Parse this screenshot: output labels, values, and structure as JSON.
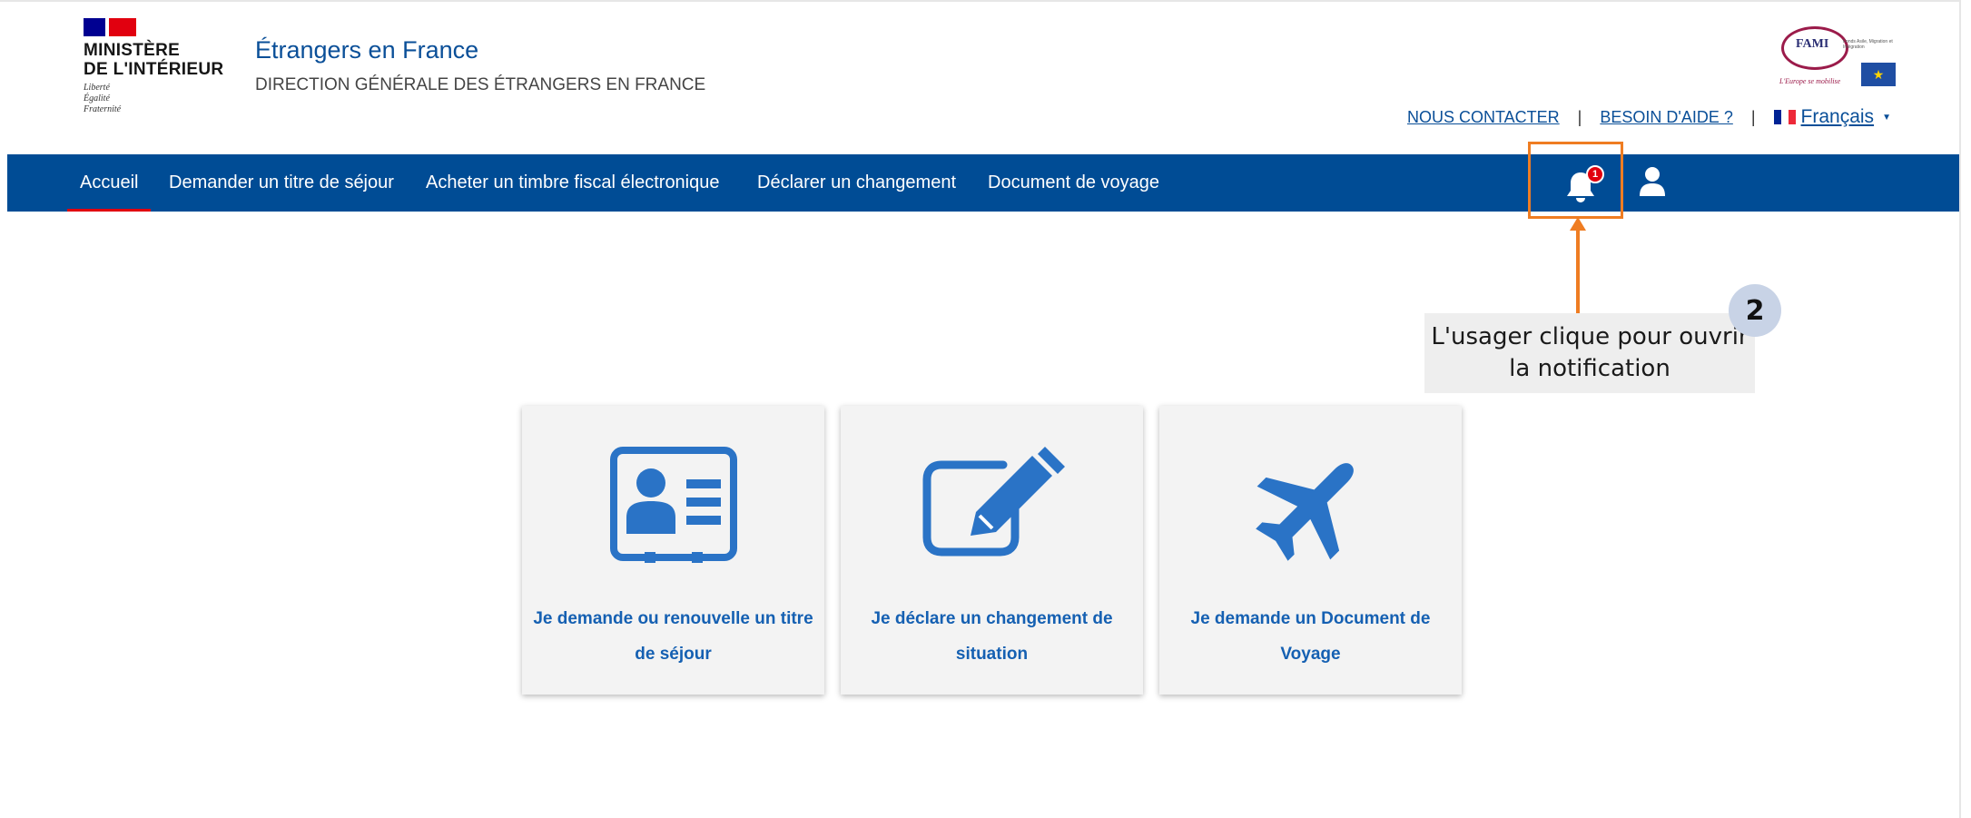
{
  "header": {
    "logo_lines": [
      "MINISTÈRE",
      "DE L'INTÉRIEUR"
    ],
    "motto": [
      "Liberté",
      "Égalité",
      "Fraternité"
    ],
    "site_title": "Étrangers en France",
    "site_subtitle": "DIRECTION GÉNÉRALE DES ÉTRANGERS EN FRANCE",
    "partner_logo": {
      "name": "FAMI",
      "caption": "Fonds Asile, Migration et Intégration",
      "tagline": "L'Europe se mobilise"
    },
    "links": {
      "contact": "NOUS CONTACTER",
      "help": "BESOIN D'AIDE ?",
      "separator": "|"
    },
    "language": {
      "selected": "Français"
    }
  },
  "nav": {
    "items": [
      {
        "label": "Accueil",
        "active": true
      },
      {
        "label": "Demander un titre de séjour",
        "active": false
      },
      {
        "label": "Acheter un timbre fiscal électronique",
        "active": false
      },
      {
        "label": "Déclarer un changement",
        "active": false
      },
      {
        "label": "Document de voyage",
        "active": false
      }
    ],
    "notification_count": "1",
    "icons": {
      "notifications": "bell-icon",
      "account": "user-icon"
    }
  },
  "annotation": {
    "step_number": "2",
    "callout": "L'usager clique pour ouvrir la notification"
  },
  "cards": [
    {
      "icon": "id-card-icon",
      "label": "Je demande ou renouvelle un titre de séjour"
    },
    {
      "icon": "edit-icon",
      "label": "Je déclare un changement de situation"
    },
    {
      "icon": "airplane-icon",
      "label": "Je demande un Document de Voyage"
    }
  ],
  "colors": {
    "navbar": "#004c95",
    "link": "#0a4f98",
    "card_text": "#1560b2",
    "icon": "#2a73c6",
    "annotation": "#ef7d22",
    "badge": "#e1000f"
  }
}
